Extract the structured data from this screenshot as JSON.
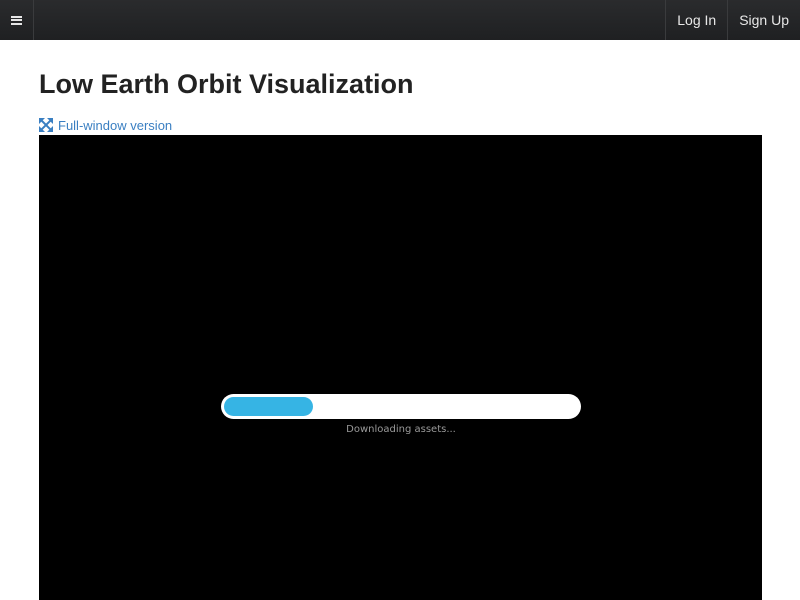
{
  "navbar": {
    "menu_icon": "hamburger-menu-icon",
    "login_label": "Log In",
    "signup_label": "Sign Up"
  },
  "page": {
    "title": "Low Earth Orbit Visualization",
    "fullwindow_icon": "expand-arrows-icon",
    "fullwindow_label": "Full-window version"
  },
  "viewer": {
    "loading_text": "Downloading assets...",
    "progress": 0.25
  },
  "colors": {
    "navbar_bg": "#222324",
    "link": "#3a7fc2",
    "progress_fill": "#36b4e4",
    "viewer_bg": "#000000"
  }
}
